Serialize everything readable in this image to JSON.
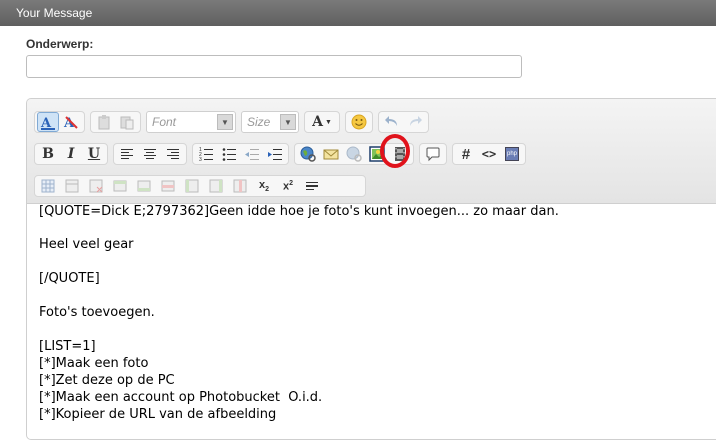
{
  "window": {
    "title": "Your Message"
  },
  "subject": {
    "label": "Onderwerp:",
    "value": ""
  },
  "toolbar": {
    "font_placeholder": "Font",
    "size_placeholder": "Size",
    "text_color_label": "A",
    "bold_label": "B",
    "italic_label": "I",
    "underline_label": "U",
    "hash_label": "#",
    "code_label": "<>",
    "php_label": "php",
    "highlighted_button": "insert-image-button"
  },
  "message": {
    "lines": [
      "[QUOTE=Dick E;2797362]Geen idde hoe je foto's kunt invoegen... zo maar dan.",
      "",
      "Heel veel gear",
      "",
      "[/QUOTE]",
      "",
      "Foto's toevoegen.",
      "",
      "[LIST=1]",
      "[*]Maak een foto",
      "[*]Zet deze op de PC",
      "[*]Maak een account op Photobucket  O.i.d.",
      "[*]Kopieer de URL van de afbeelding"
    ]
  },
  "colors": {
    "highlight_circle": "#e0121b",
    "title_bar": "#6b6b6b",
    "spellcheck_underline": "#e03030"
  }
}
